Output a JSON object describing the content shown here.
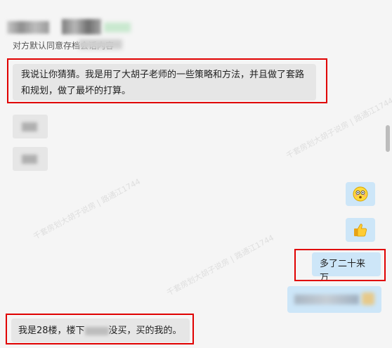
{
  "header": {
    "subtitle": "对方默认同意存档会话内容"
  },
  "messages": {
    "msg1": "我说让你猜猜。我是用了大胡子老师的一些策略和方法，并且做了套路和规划，做了最坏的打算。",
    "msg_right_1": "多了二十来万",
    "msg_last_a": "我是28楼，楼下",
    "msg_last_b": "没买，买的我的。"
  },
  "emojis": {
    "first": "😳",
    "second": "👍"
  },
  "watermark": "千套房划大胡子说房 | 路通江1744"
}
